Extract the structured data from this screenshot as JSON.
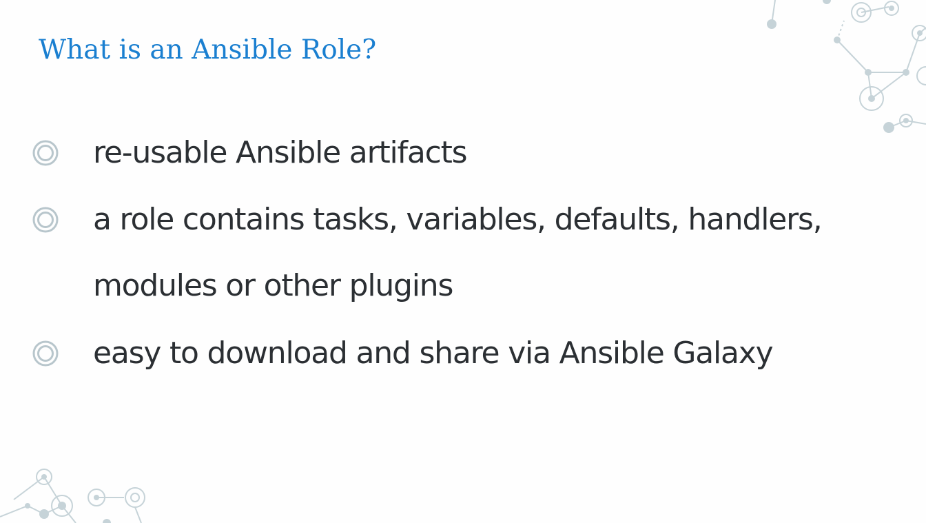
{
  "slide": {
    "title": "What is an Ansible Role?",
    "bullets": [
      {
        "text": "re-usable Ansible artifacts",
        "marker_icon": "double-circle-bullet-icon"
      },
      {
        "text": "a role contains tasks, variables, defaults, handlers, modules or other plugins",
        "marker_icon": "double-circle-bullet-icon"
      },
      {
        "text": "easy to download and share via Ansible Galaxy",
        "marker_icon": "double-circle-bullet-icon"
      }
    ],
    "decorations": [
      "molecule-network-decoration",
      "molecule-network-decoration"
    ]
  },
  "colors": {
    "title": "#1a7fd0",
    "body_text": "#2b2f33",
    "bullet_marker": "#b8c6cc",
    "decoration": "#c6d3d8",
    "background": "#fefefe"
  }
}
